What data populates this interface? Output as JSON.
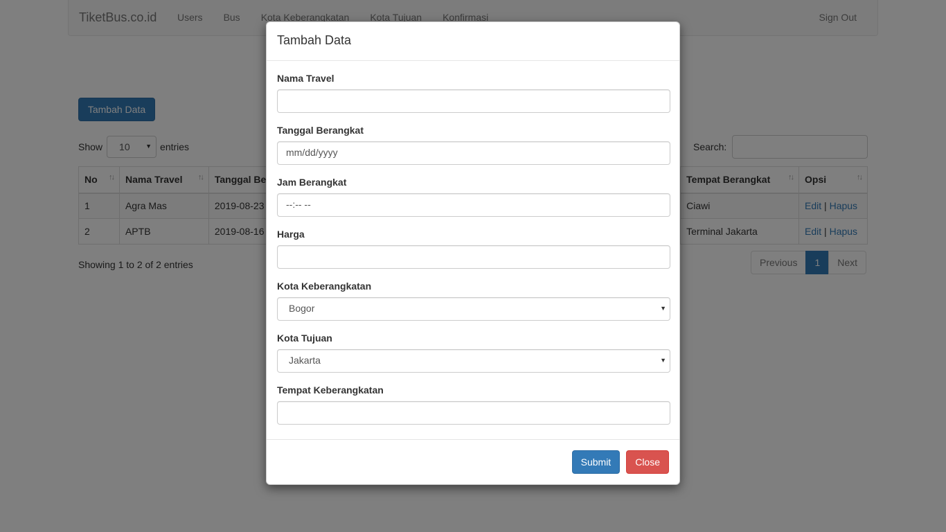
{
  "navbar": {
    "brand": "TiketBus.co.id",
    "links": [
      "Users",
      "Bus",
      "Kota Keberangkatan",
      "Kota Tujuan",
      "Konfirmasi"
    ],
    "sign_out": "Sign Out"
  },
  "page": {
    "add_button": "Tambah Data",
    "show_label": "Show",
    "entries_label": "entries",
    "page_length": "10",
    "search_label": "Search:",
    "info": "Showing 1 to 2 of 2 entries"
  },
  "table": {
    "headers": [
      "No",
      "Nama Travel",
      "Tanggal Be",
      "Tempat Berangkat",
      "Opsi"
    ],
    "rows": [
      {
        "no": "1",
        "nama": "Agra Mas",
        "tanggal": "2019-08-23",
        "tempat": "Ciawi"
      },
      {
        "no": "2",
        "nama": "APTB",
        "tanggal": "2019-08-16",
        "tempat": "Terminal Jakarta"
      }
    ],
    "edit_label": "Edit",
    "separator": "|",
    "delete_label": "Hapus"
  },
  "pagination": {
    "previous": "Previous",
    "current": "1",
    "next": "Next"
  },
  "modal": {
    "title": "Tambah Data",
    "fields": {
      "nama_travel": {
        "label": "Nama Travel",
        "value": ""
      },
      "tanggal_berangkat": {
        "label": "Tanggal Berangkat",
        "placeholder": "mm/dd/yyyy"
      },
      "jam_berangkat": {
        "label": "Jam Berangkat",
        "placeholder": "--:-- --"
      },
      "harga": {
        "label": "Harga",
        "value": ""
      },
      "kota_keberangkatan": {
        "label": "Kota Keberangkatan",
        "selected": "Bogor"
      },
      "kota_tujuan": {
        "label": "Kota Tujuan",
        "selected": "Jakarta"
      },
      "tempat_keberangkatan": {
        "label": "Tempat Keberangkatan",
        "value": ""
      }
    },
    "submit": "Submit",
    "close": "Close"
  },
  "icons": {
    "sort": "sort-icon",
    "dropdown": "caret-down-icon"
  },
  "colors": {
    "primary": "#337ab7",
    "danger": "#d9534f",
    "overlay": "rgba(0,0,0,0.5)"
  }
}
